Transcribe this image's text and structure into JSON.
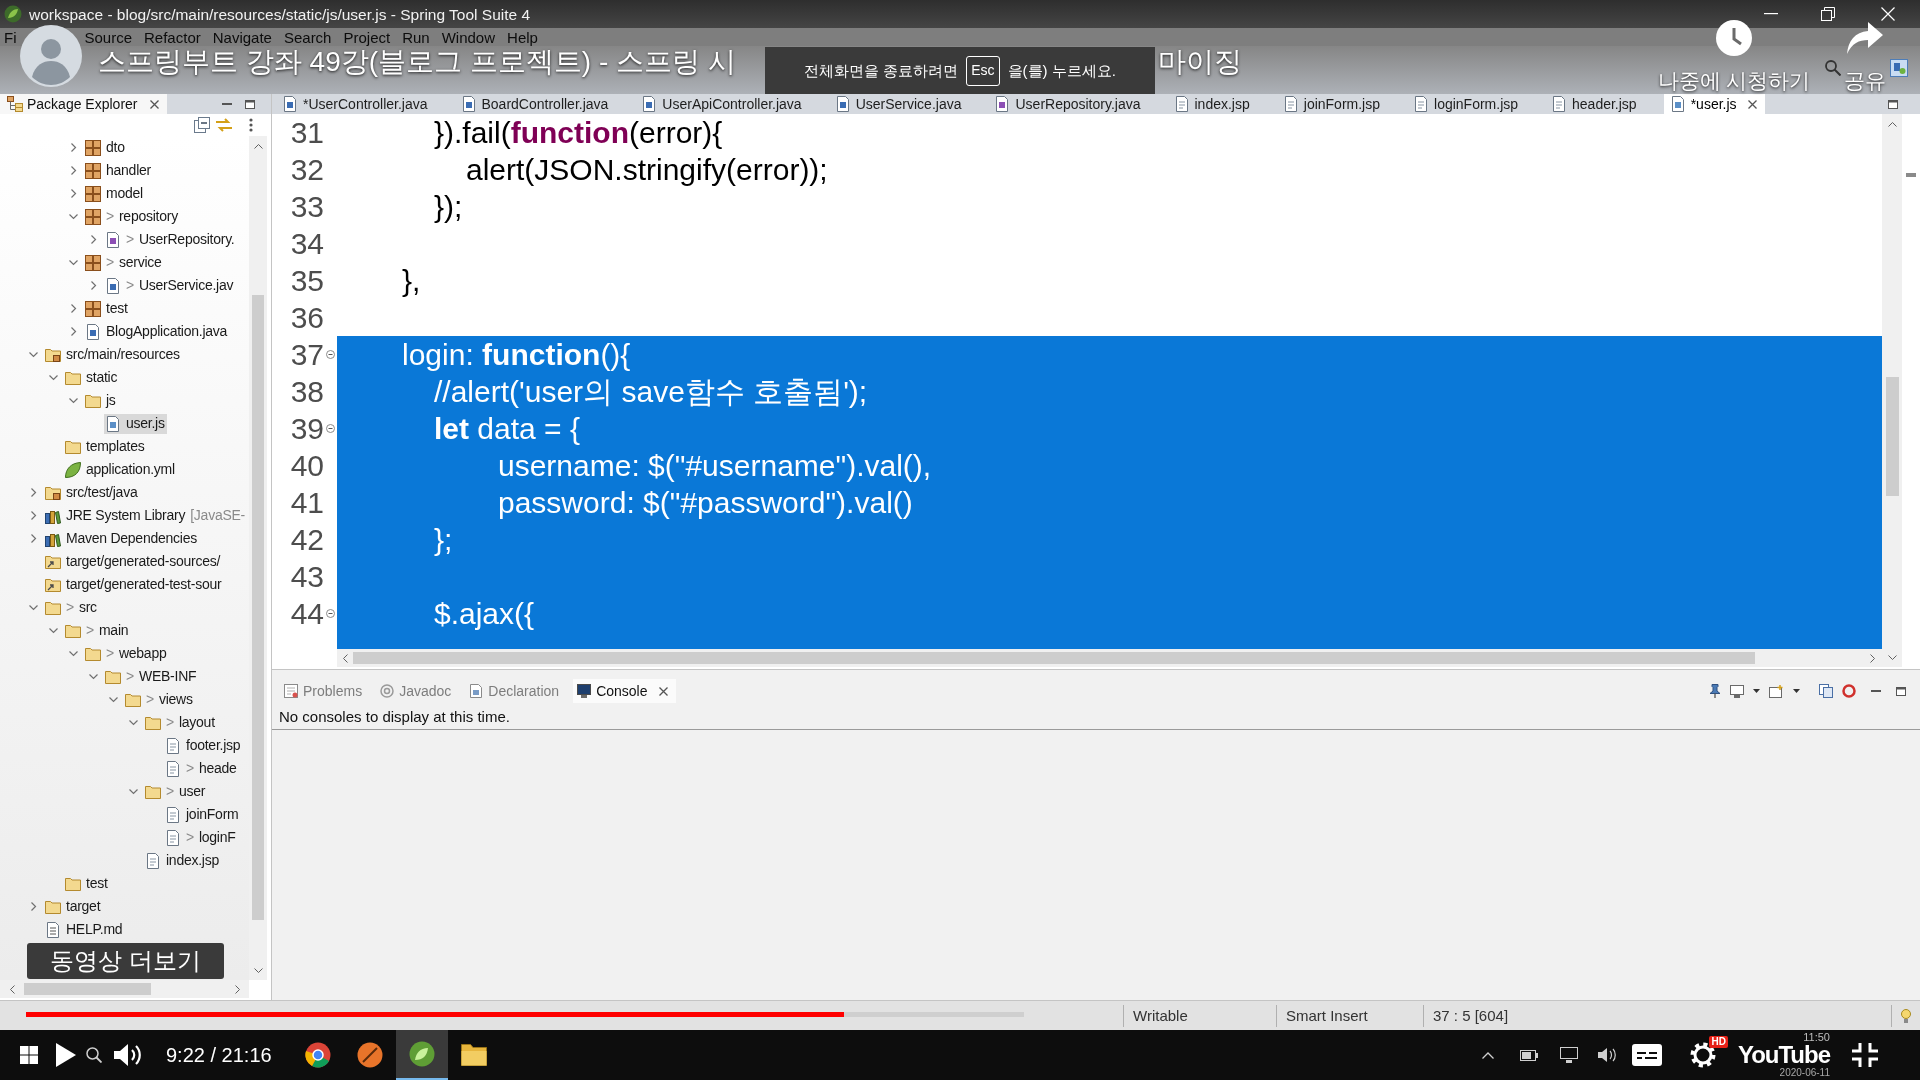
{
  "window": {
    "title": "workspace - blog/src/main/resources/static/js/user.js - Spring Tool Suite 4"
  },
  "menu": [
    "Fi",
    "Source",
    "Refactor",
    "Navigate",
    "Search",
    "Project",
    "Run",
    "Window",
    "Help"
  ],
  "video_overlay": {
    "title_parts": [
      "스프링부트 강좌 49강(블로그 프로젝트) - 스프링 시",
      "마이징"
    ],
    "fullscreen_notice": {
      "before": "전체화면을 종료하려면",
      "key": "Esc",
      "after": "을(를) 누르세요."
    },
    "watch_later": "나중에 시청하기",
    "share": "공유",
    "more_videos": "동영상 더보기"
  },
  "package_explorer": {
    "title": "Package Explorer",
    "tree_continued": [
      {
        "label": "dto",
        "kind": "package",
        "expanded": false,
        "selected": false
      },
      {
        "label": "handler",
        "kind": "package",
        "expanded": false,
        "selected": false
      },
      {
        "label": "model",
        "kind": "package",
        "expanded": false,
        "selected": false
      },
      {
        "label": "repository",
        "prefix": ">",
        "kind": "package",
        "expanded": true,
        "selected": false,
        "children": [
          {
            "label": "UserRepository.",
            "prefix": ">",
            "kind": "interface",
            "expanded": false,
            "selected": false
          }
        ]
      },
      {
        "label": "service",
        "prefix": ">",
        "kind": "package",
        "expanded": true,
        "selected": false,
        "children": [
          {
            "label": "UserService.jav",
            "prefix": ">",
            "kind": "java",
            "expanded": false,
            "selected": false
          }
        ]
      },
      {
        "label": "test",
        "kind": "package",
        "expanded": false,
        "selected": false
      },
      {
        "label": "BlogApplication.java",
        "kind": "java",
        "expanded": false,
        "selected": false
      }
    ],
    "tree": [
      {
        "label": "src/main/resources",
        "kind": "source_folder",
        "expanded": true,
        "selected": false,
        "children": [
          {
            "label": "static",
            "kind": "folder",
            "expanded": true,
            "selected": false,
            "children": [
              {
                "label": "js",
                "kind": "folder",
                "expanded": true,
                "selected": false,
                "children": [
                  {
                    "label": "user.js",
                    "kind": "js",
                    "selected": true
                  }
                ]
              }
            ]
          },
          {
            "label": "templates",
            "kind": "folder",
            "selected": false
          },
          {
            "label": "application.yml",
            "kind": "yml",
            "selected": false
          }
        ]
      },
      {
        "label": "src/test/java",
        "kind": "source_folder",
        "expanded": false,
        "selected": false
      },
      {
        "label": "JRE System Library",
        "suffix": "[JavaSE-",
        "kind": "library",
        "expanded": false,
        "selected": false
      },
      {
        "label": "Maven Dependencies",
        "kind": "library",
        "expanded": false,
        "selected": false
      },
      {
        "label": "target/generated-sources/",
        "kind": "folder_link",
        "selected": false
      },
      {
        "label": "target/generated-test-sour",
        "kind": "folder_link",
        "selected": false
      },
      {
        "label": "src",
        "prefix": ">",
        "kind": "folder",
        "expanded": true,
        "selected": false,
        "children": [
          {
            "label": "main",
            "prefix": ">",
            "kind": "folder",
            "expanded": true,
            "selected": false,
            "children": [
              {
                "label": "webapp",
                "prefix": ">",
                "kind": "folder",
                "expanded": true,
                "selected": false,
                "children": [
                  {
                    "label": "WEB-INF",
                    "prefix": ">",
                    "kind": "folder",
                    "expanded": true,
                    "selected": false,
                    "children": [
                      {
                        "label": "views",
                        "prefix": ">",
                        "kind": "folder",
                        "expanded": true,
                        "selected": false,
                        "children": [
                          {
                            "label": "layout",
                            "prefix": ">",
                            "kind": "folder",
                            "expanded": true,
                            "selected": false,
                            "children": [
                              {
                                "label": "footer.jsp",
                                "kind": "jsp",
                                "selected": false
                              },
                              {
                                "label": "heade",
                                "prefix": ">",
                                "kind": "jsp",
                                "selected": false
                              }
                            ]
                          },
                          {
                            "label": "user",
                            "prefix": ">",
                            "kind": "folder",
                            "expanded": true,
                            "selected": false,
                            "children": [
                              {
                                "label": "joinForm",
                                "kind": "jsp",
                                "selected": false
                              },
                              {
                                "label": "loginF",
                                "prefix": ">",
                                "kind": "jsp",
                                "selected": false
                              }
                            ]
                          },
                          {
                            "label": "index.jsp",
                            "kind": "jsp",
                            "selected": false
                          }
                        ]
                      }
                    ]
                  }
                ]
              }
            ]
          },
          {
            "label": "test",
            "kind": "folder",
            "selected": false
          }
        ]
      },
      {
        "label": "target",
        "kind": "folder",
        "expanded": false,
        "selected": false
      },
      {
        "label": "HELP.md",
        "kind": "file",
        "selected": false
      }
    ]
  },
  "editor": {
    "tabs": [
      {
        "label": "*UserController.java",
        "kind": "java",
        "selected": false
      },
      {
        "label": "BoardController.java",
        "kind": "java",
        "selected": false
      },
      {
        "label": "UserApiController.java",
        "kind": "java",
        "selected": false
      },
      {
        "label": "UserService.java",
        "kind": "java",
        "selected": false
      },
      {
        "label": "UserRepository.java",
        "kind": "interface",
        "selected": false
      },
      {
        "label": "index.jsp",
        "kind": "jsp",
        "selected": false
      },
      {
        "label": "joinForm.jsp",
        "kind": "jsp",
        "selected": false
      },
      {
        "label": "loginForm.jsp",
        "kind": "jsp",
        "selected": false
      },
      {
        "label": "header.jsp",
        "kind": "jsp",
        "selected": false
      },
      {
        "label": "*user.js",
        "kind": "js",
        "selected": true
      }
    ],
    "lines": [
      {
        "number": "31",
        "fold": false,
        "selected": false,
        "segments": [
          {
            "text": "\t\t}).fail(",
            "kind": "plain"
          },
          {
            "text": "function",
            "kind": "keyword"
          },
          {
            "text": "(error){",
            "kind": "plain"
          }
        ]
      },
      {
        "number": "32",
        "fold": false,
        "selected": false,
        "segments": [
          {
            "text": "\t\t\talert(JSON.stringify(error));",
            "kind": "plain"
          }
        ]
      },
      {
        "number": "33",
        "fold": false,
        "selected": false,
        "segments": [
          {
            "text": "\t\t});",
            "kind": "plain"
          }
        ]
      },
      {
        "number": "34",
        "fold": false,
        "selected": false
      },
      {
        "number": "35",
        "fold": false,
        "selected": false,
        "segments": [
          {
            "text": "\t},",
            "kind": "plain"
          }
        ]
      },
      {
        "number": "36",
        "fold": false,
        "selected": false
      },
      {
        "number": "37",
        "fold": true,
        "selected": true,
        "segments": [
          {
            "text": "\tlogin: ",
            "kind": "plain"
          },
          {
            "text": "function",
            "kind": "keyword"
          },
          {
            "text": "(){",
            "kind": "plain"
          }
        ]
      },
      {
        "number": "38",
        "fold": false,
        "selected": true,
        "segments": [
          {
            "text": "\t\t//alert('user의 save함수 호출됨');",
            "kind": "comment"
          }
        ]
      },
      {
        "number": "39",
        "fold": true,
        "selected": true,
        "segments": [
          {
            "text": "\t\tlet",
            "kind": "keyword"
          },
          {
            "text": " data = {",
            "kind": "plain"
          }
        ]
      },
      {
        "number": "40",
        "fold": false,
        "selected": true,
        "segments": [
          {
            "text": "\t\t\t\tusername: $(\"#username\").val(),",
            "kind": "plain"
          }
        ]
      },
      {
        "number": "41",
        "fold": false,
        "selected": true,
        "segments": [
          {
            "text": "\t\t\t\tpassword: $(\"#password\").val()",
            "kind": "plain"
          }
        ]
      },
      {
        "number": "42",
        "fold": false,
        "selected": true,
        "segments": [
          {
            "text": "\t\t};",
            "kind": "plain"
          }
        ]
      },
      {
        "number": "43",
        "fold": false,
        "selected": true
      },
      {
        "number": "44",
        "fold": true,
        "selected": true,
        "segments": [
          {
            "text": "\t\t$.ajax({",
            "kind": "plain"
          }
        ]
      }
    ]
  },
  "console": {
    "tabs": [
      {
        "label": "Problems",
        "kind": "problems",
        "selected": false
      },
      {
        "label": "Javadoc",
        "kind": "javadoc",
        "selected": false
      },
      {
        "label": "Declaration",
        "kind": "declaration",
        "selected": false
      },
      {
        "label": "Console",
        "kind": "console",
        "selected": true
      }
    ],
    "message": "No consoles to display at this time."
  },
  "status_bar": [
    "Writable",
    "Smart Insert",
    "37 : 5 [604]"
  ],
  "player": {
    "progress": {
      "level": 0.82
    },
    "time": "9:22 / 21:16",
    "quality_badge": "HD",
    "logo": "YouTube",
    "clock": {
      "time": "11:50",
      "date": "2020-06-11"
    }
  },
  "taskbar": {
    "apps": [
      {
        "kind": "browser",
        "selected": false
      },
      {
        "kind": "round",
        "selected": false
      },
      {
        "kind": "leaf",
        "selected": true
      },
      {
        "kind": "folder",
        "selected": false
      }
    ]
  }
}
